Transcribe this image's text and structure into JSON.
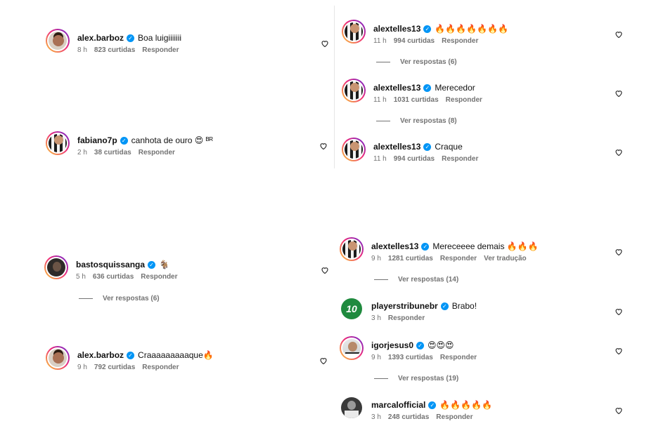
{
  "left_column": [
    {
      "username": "alex.barboz",
      "verified": true,
      "text": "Boa luigiiiiiii",
      "time": "8 h",
      "likes": "823 curtidas",
      "reply": "Responder",
      "avatar": "face"
    },
    {
      "username": "fabiano7p",
      "verified": true,
      "text": "canhota de ouro 😍 ᴮᴿ",
      "time": "2 h",
      "likes": "38 curtidas",
      "reply": "Responder",
      "avatar": "stripes"
    },
    {
      "username": "bastosquissanga",
      "verified": true,
      "text": "🐐",
      "time": "5 h",
      "likes": "636 curtidas",
      "reply": "Responder",
      "avatar": "dark",
      "view_replies": "Ver respostas (6)"
    },
    {
      "username": "alex.barboz",
      "verified": true,
      "text": "Craaaaaaaaaque🔥",
      "time": "9 h",
      "likes": "792 curtidas",
      "reply": "Responder",
      "avatar": "face"
    }
  ],
  "right_column": [
    {
      "username": "alextelles13",
      "verified": true,
      "text": "🔥🔥🔥🔥🔥🔥🔥",
      "time": "11 h",
      "likes": "994 curtidas",
      "reply": "Responder",
      "avatar": "stripes",
      "view_replies": "Ver respostas (6)"
    },
    {
      "username": "alextelles13",
      "verified": true,
      "text": "Merecedor",
      "time": "11 h",
      "likes": "1031 curtidas",
      "reply": "Responder",
      "avatar": "stripes",
      "view_replies": "Ver respostas (8)"
    },
    {
      "username": "alextelles13",
      "verified": true,
      "text": "Craque",
      "time": "11 h",
      "likes": "994 curtidas",
      "reply": "Responder",
      "avatar": "stripes"
    },
    {
      "username": "alextelles13",
      "verified": true,
      "text": "Mereceeee demais 🔥🔥🔥",
      "time": "9 h",
      "likes": "1281 curtidas",
      "reply": "Responder",
      "translate": "Ver tradução",
      "avatar": "stripes",
      "view_replies": "Ver respostas (14)"
    },
    {
      "username": "playerstribunebr",
      "verified": true,
      "text": "Brabo!",
      "time": "3 h",
      "reply": "Responder",
      "avatar": "green",
      "avatar_text": "10"
    },
    {
      "username": "igorjesus0",
      "verified": true,
      "text": "😍😍😍",
      "time": "9 h",
      "likes": "1393 curtidas",
      "reply": "Responder",
      "avatar": "brazil",
      "view_replies": "Ver respostas (19)"
    },
    {
      "username": "marcalofficial",
      "verified": true,
      "text": "🔥🔥🔥🔥🔥",
      "time": "3 h",
      "likes": "248 curtidas",
      "reply": "Responder",
      "avatar": "bw"
    }
  ],
  "icons": {
    "verified": "verified-badge-icon",
    "like": "heart-outline-icon"
  },
  "colors": {
    "verified": "#0095f6",
    "meta": "#737373",
    "text": "#111111"
  }
}
